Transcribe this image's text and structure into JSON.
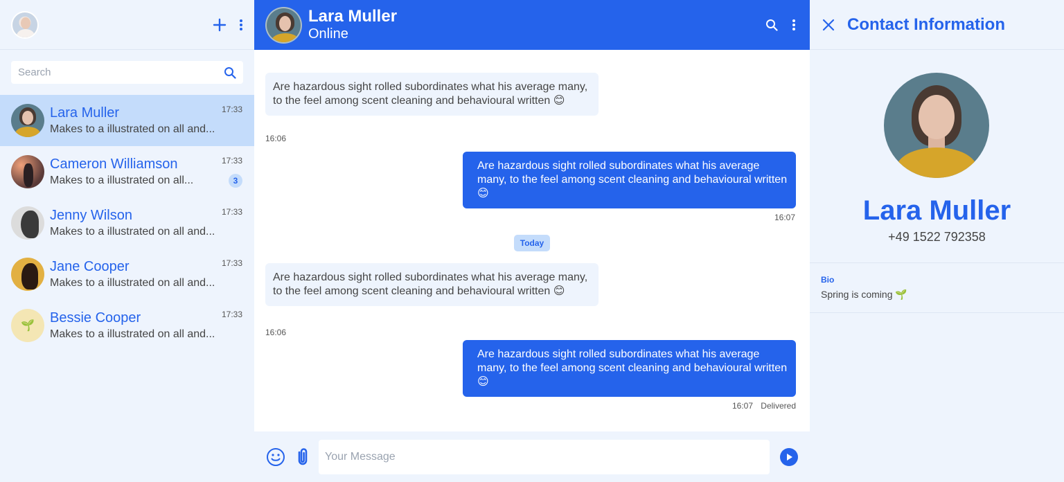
{
  "sidebar": {
    "search_placeholder": "Search",
    "contacts": [
      {
        "name": "Lara Muller",
        "preview": "Makes to a illustrated on all and...",
        "time": "17:33",
        "badge": ""
      },
      {
        "name": "Cameron Williamson",
        "preview": "Makes to a illustrated on all...",
        "time": "17:33",
        "badge": "3"
      },
      {
        "name": "Jenny Wilson",
        "preview": "Makes to a illustrated on all and...",
        "time": "17:33",
        "badge": ""
      },
      {
        "name": "Jane Cooper",
        "preview": "Makes to a illustrated on all and...",
        "time": "17:33",
        "badge": ""
      },
      {
        "name": "Bessie Cooper",
        "preview": "Makes to a illustrated on all and...",
        "time": "17:33",
        "badge": ""
      }
    ]
  },
  "chat": {
    "contact_name": "Lara Muller",
    "status": "Online",
    "messages": [
      {
        "direction": "in",
        "text": "Are hazardous sight rolled subordinates what his average many, to the feel among scent cleaning and behavioural written 😊",
        "time": "16:06"
      },
      {
        "direction": "out",
        "text": "Are hazardous sight rolled subordinates what his average many, to the feel among scent cleaning and behavioural written 😊",
        "time": "16:07"
      },
      {
        "direction": "in",
        "text": "Are hazardous sight rolled subordinates what his average many, to the feel among scent cleaning and behavioural written 😊",
        "time": "16:06"
      },
      {
        "direction": "out",
        "text": "Are hazardous sight rolled subordinates what his average many, to the feel among scent cleaning and behavioural written 😊",
        "time": "16:07",
        "status": "Delivered"
      }
    ],
    "day_separator": "Today",
    "composer_placeholder": "Your Message"
  },
  "info_panel": {
    "title": "Contact Information",
    "name": "Lara Muller",
    "phone": "+49 1522 792358",
    "bio_label": "Bio",
    "bio_text": "Spring is coming 🌱"
  },
  "colors": {
    "accent": "#2563eb",
    "panel_bg": "#eef4fd",
    "active_bg": "#c4dcfb"
  },
  "icons": [
    "plus-icon",
    "more-vertical-icon",
    "search-icon",
    "close-icon",
    "emoji-icon",
    "attachment-icon",
    "send-icon",
    "sprout-icon"
  ]
}
